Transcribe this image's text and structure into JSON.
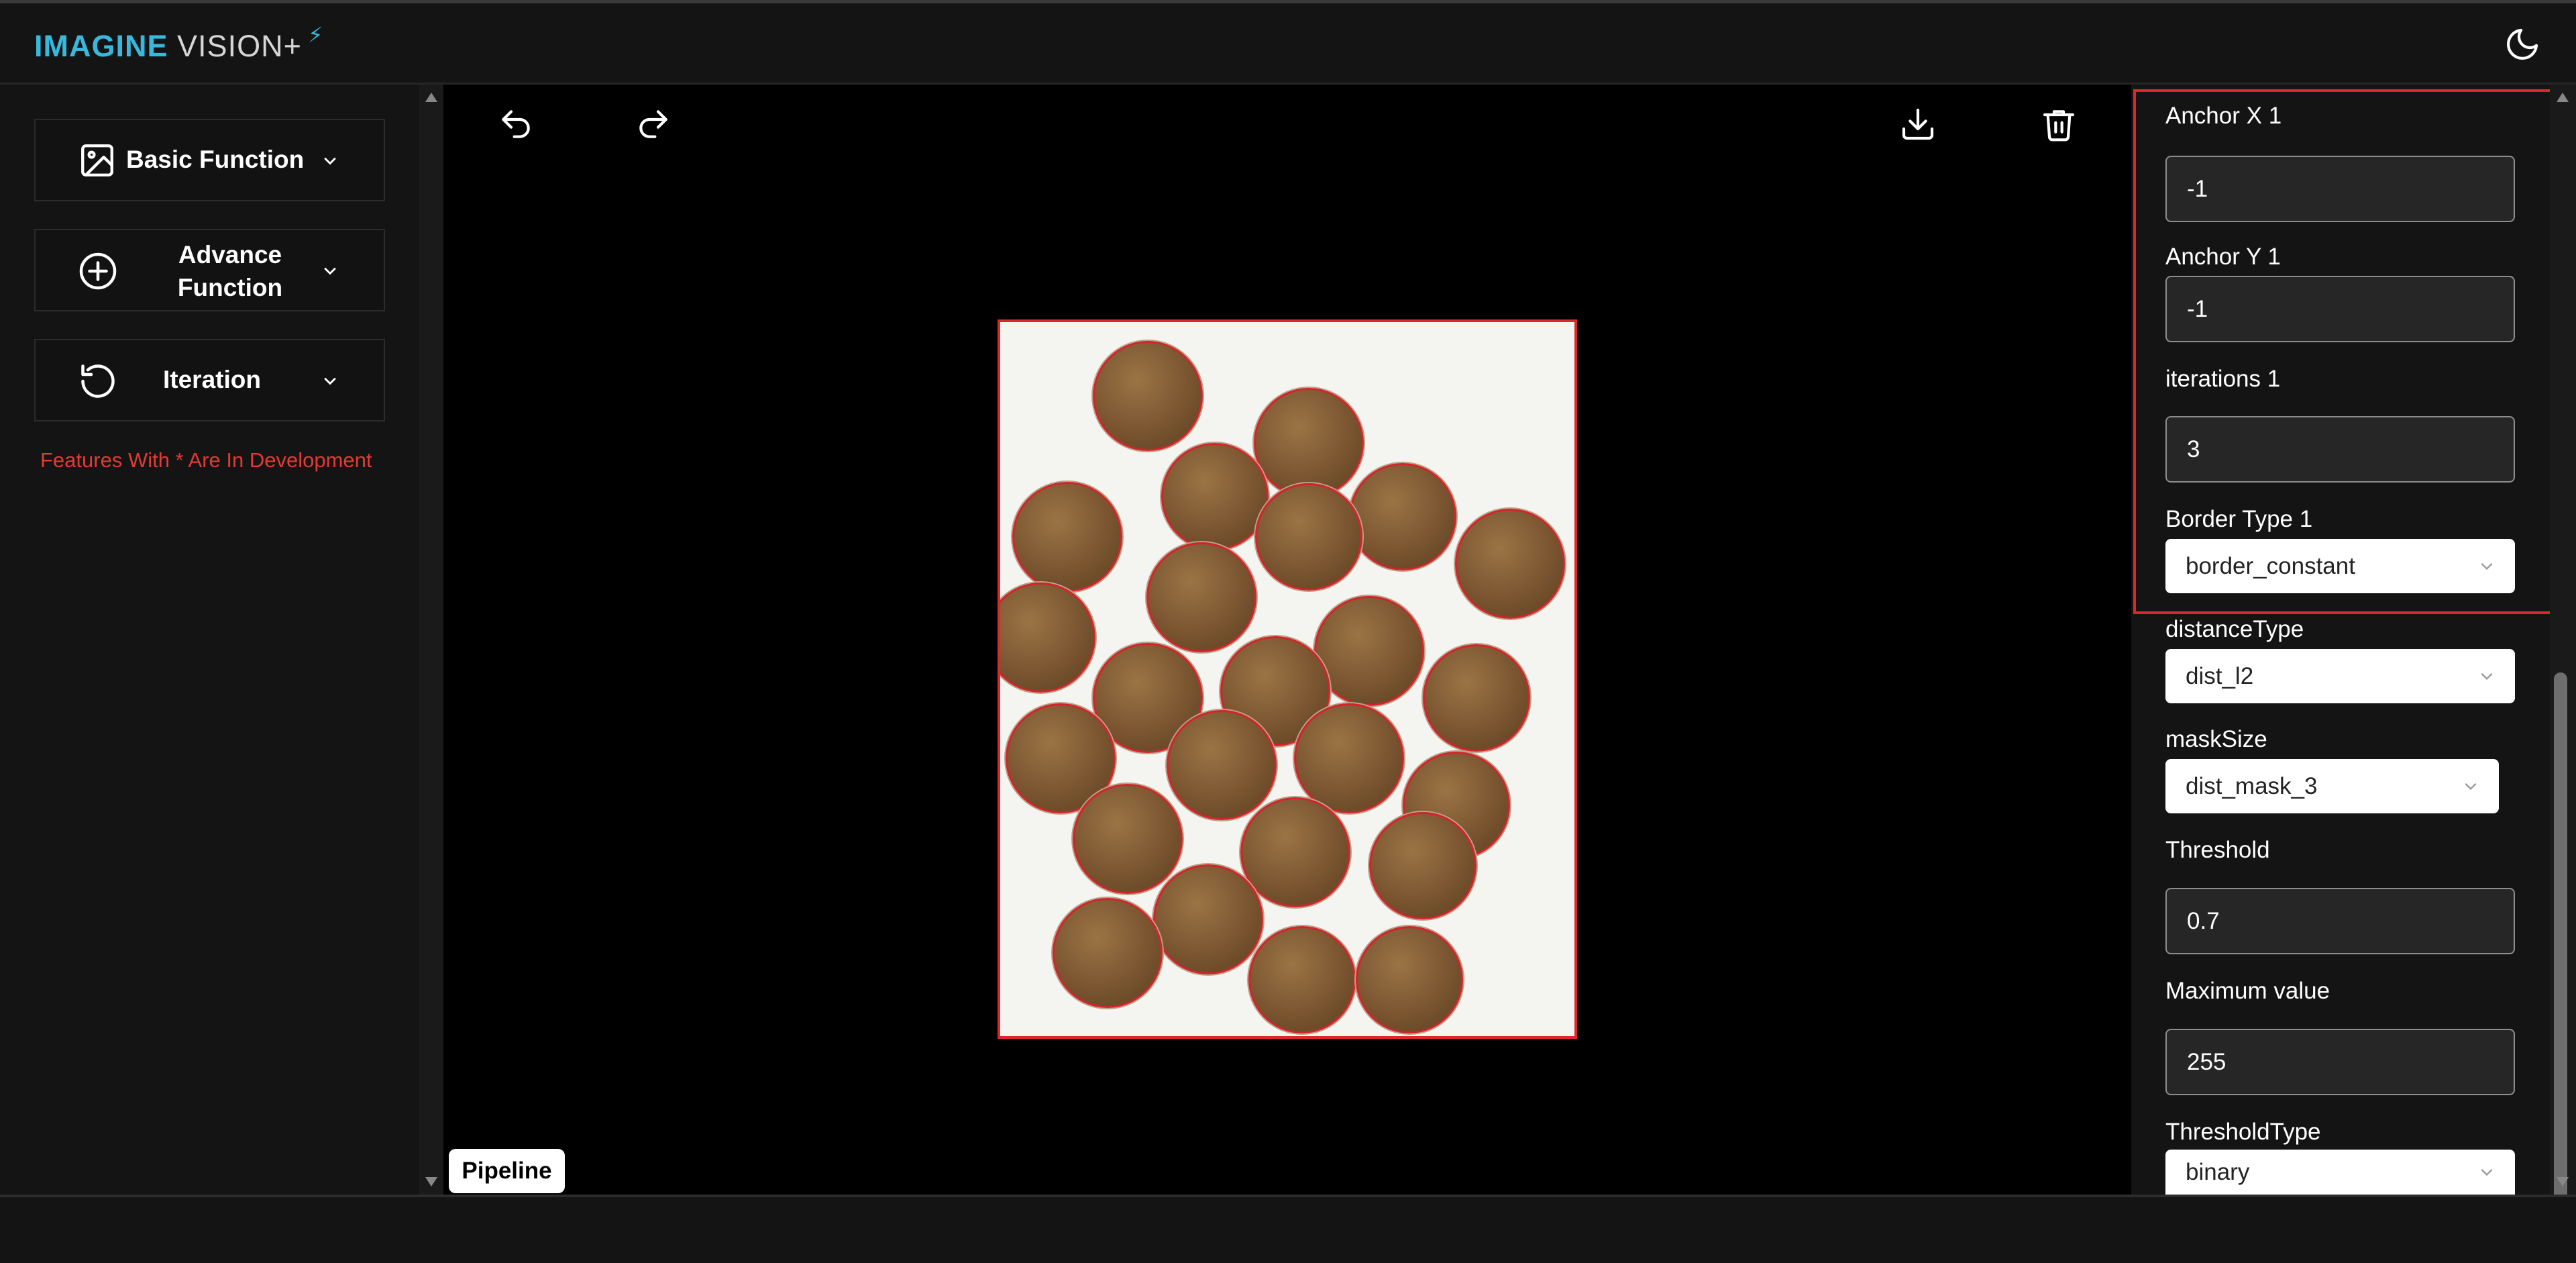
{
  "app": {
    "logo_part1": "IMAGINE",
    "logo_part2": "VISION+",
    "logo_bolt": "⚡",
    "theme_icon": "moon-icon"
  },
  "sidebar": {
    "items": [
      {
        "label": "Basic Function",
        "icon": "image-icon"
      },
      {
        "label": "Advance Function",
        "icon": "plus-circle-icon"
      },
      {
        "label": "Iteration",
        "icon": "rotate-icon"
      }
    ],
    "dev_note": "Features With * Are In Development"
  },
  "toolbar": {
    "undo_icon": "undo-icon",
    "redo_icon": "redo-icon",
    "download_icon": "download-icon",
    "delete_icon": "trash-icon"
  },
  "canvas": {
    "image_desc": "coins-image",
    "pipeline_label": "Pipeline"
  },
  "params": {
    "anchor_x_label": "Anchor X 1",
    "anchor_x_value": "-1",
    "anchor_y_label": "Anchor Y 1",
    "anchor_y_value": "-1",
    "iterations_label": "iterations 1",
    "iterations_value": "3",
    "border_type_label": "Border Type 1",
    "border_type_value": "border_constant",
    "distance_type_label": "distanceType",
    "distance_type_value": "dist_l2",
    "mask_size_label": "maskSize",
    "mask_size_value": "dist_mask_3",
    "threshold_label": "Threshold",
    "threshold_value": "0.7",
    "max_value_label": "Maximum value",
    "max_value_value": "255",
    "threshold_type_label": "ThresholdType",
    "threshold_type_value": "binary"
  },
  "colors": {
    "accent": "#39b8dd",
    "highlight": "#e0262b",
    "note": "#e53935"
  }
}
